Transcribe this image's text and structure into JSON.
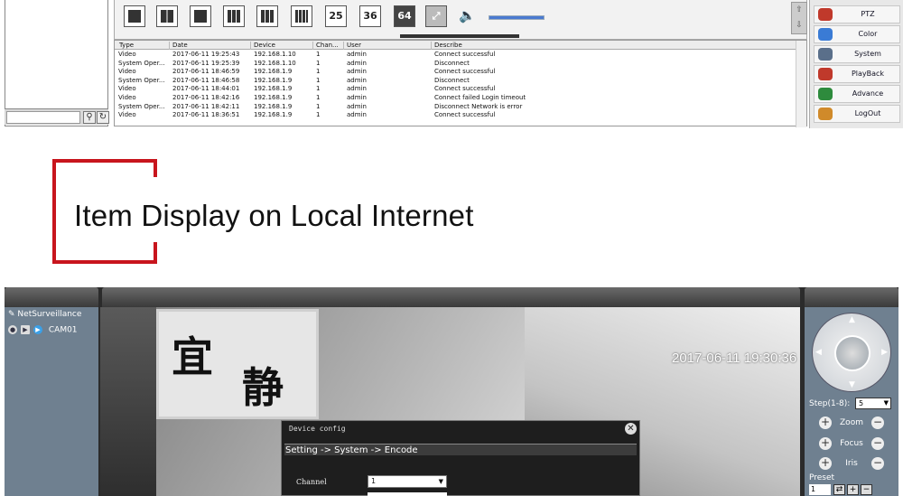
{
  "top_app": {
    "toolbar": {
      "layouts": [
        {
          "name": "layout-1-button",
          "label": ""
        },
        {
          "name": "layout-4-button",
          "label": ""
        },
        {
          "name": "layout-6-button",
          "label": ""
        },
        {
          "name": "layout-9-button",
          "label": ""
        },
        {
          "name": "layout-13-button",
          "label": ""
        },
        {
          "name": "layout-16-button",
          "label": ""
        },
        {
          "name": "layout-25-button",
          "label": "25"
        },
        {
          "name": "layout-36-button",
          "label": "36"
        },
        {
          "name": "layout-64-button",
          "label": "64"
        }
      ],
      "volume_level": 1.0
    },
    "log": {
      "columns": [
        "Type",
        "Date",
        "Device",
        "Chan...",
        "User",
        "Describe"
      ],
      "rows": [
        [
          "Video",
          "2017-06-11 19:25:43",
          "192.168.1.10",
          "1",
          "admin",
          "Connect successful"
        ],
        [
          "System Oper...",
          "2017-06-11 19:25:39",
          "192.168.1.10",
          "1",
          "admin",
          "Disconnect"
        ],
        [
          "Video",
          "2017-06-11 18:46:59",
          "192.168.1.9",
          "1",
          "admin",
          "Connect successful"
        ],
        [
          "System Oper...",
          "2017-06-11 18:46:58",
          "192.168.1.9",
          "1",
          "admin",
          "Disconnect"
        ],
        [
          "Video",
          "2017-06-11 18:44:01",
          "192.168.1.9",
          "1",
          "admin",
          "Connect successful"
        ],
        [
          "Video",
          "2017-06-11 18:42:16",
          "192.168.1.9",
          "1",
          "admin",
          "Connect failed Login timeout"
        ],
        [
          "System Oper...",
          "2017-06-11 18:42:11",
          "192.168.1.9",
          "1",
          "admin",
          "Disconnect Network is error"
        ],
        [
          "Video",
          "2017-06-11 18:36:51",
          "192.168.1.9",
          "1",
          "admin",
          "Connect successful"
        ]
      ]
    },
    "side_menu": [
      {
        "label": "PTZ",
        "icon": "ptz-icon",
        "color": "#c0392b"
      },
      {
        "label": "Color",
        "icon": "color-icon",
        "color": "#3a7bd5"
      },
      {
        "label": "System",
        "icon": "system-icon",
        "color": "#5a6f8a"
      },
      {
        "label": "PlayBack",
        "icon": "playback-icon",
        "color": "#c0392b"
      },
      {
        "label": "Advance",
        "icon": "advance-icon",
        "color": "#2e8b3d"
      },
      {
        "label": "LogOut",
        "icon": "logout-icon",
        "color": "#d08a2a"
      }
    ]
  },
  "heading": {
    "text": "Item Display on Local Internet",
    "accent": "#c8151d"
  },
  "bottom_app": {
    "tree": {
      "root": "NetSurveillance",
      "camera": "CAM01"
    },
    "video": {
      "osd_time": "2017-06-11 19:30:36",
      "banner_chars": [
        "宜",
        "静"
      ]
    },
    "dialog": {
      "title": "Device config",
      "breadcrumb": "Setting -> System -> Encode",
      "channel_label": "Channel",
      "channel_value": "1"
    },
    "ptz": {
      "step_label": "Step(1-8):",
      "step_value": "5",
      "controls": [
        "Zoom",
        "Focus",
        "Iris"
      ],
      "preset_label": "Preset",
      "preset_value": "1"
    }
  }
}
